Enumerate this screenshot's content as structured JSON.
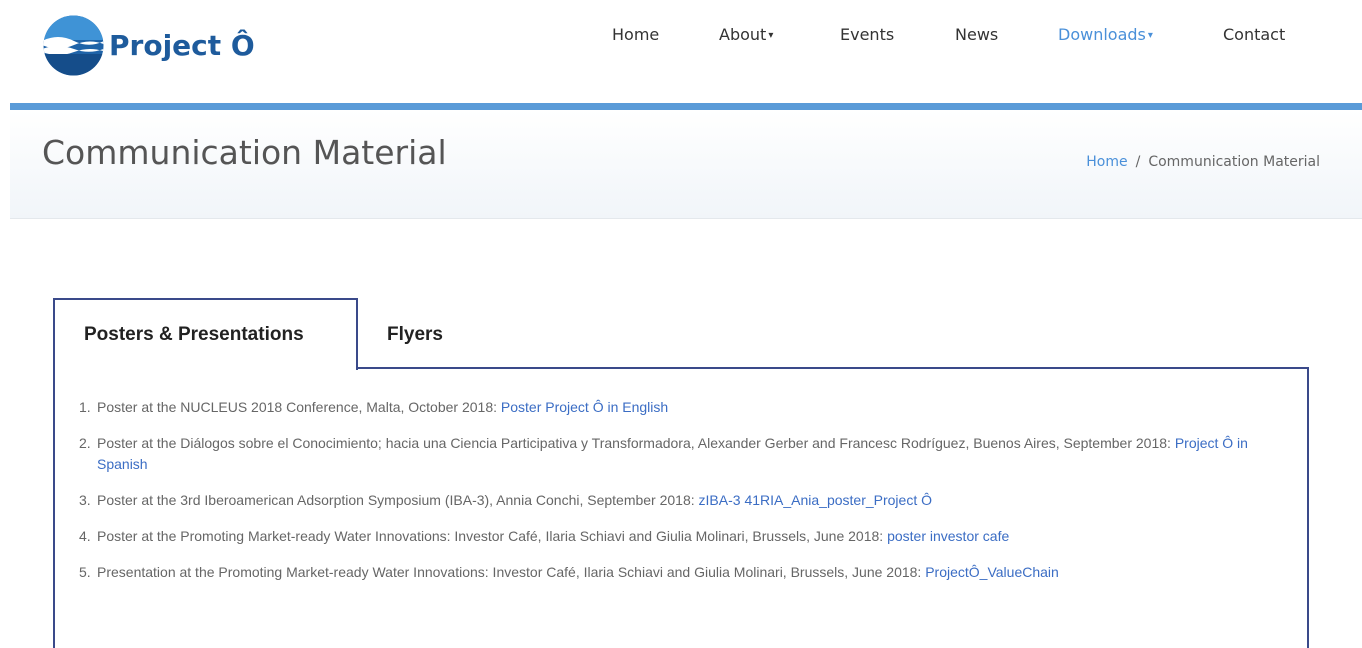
{
  "brand": {
    "name": "Project Ô",
    "logo_icon": "wave-globe-logo",
    "color": "#1e5b9c"
  },
  "nav": {
    "items": [
      {
        "label": "Home",
        "has_caret": false,
        "active": false
      },
      {
        "label": "About",
        "has_caret": true,
        "active": false
      },
      {
        "label": "Events",
        "has_caret": false,
        "active": false
      },
      {
        "label": "News",
        "has_caret": false,
        "active": false
      },
      {
        "label": "Downloads",
        "has_caret": true,
        "active": true
      },
      {
        "label": "Contact",
        "has_caret": false,
        "active": false
      }
    ],
    "accent_color": "#4a90d9"
  },
  "page": {
    "title": "Communication Material",
    "breadcrumb": {
      "home": "Home",
      "separator": "/",
      "current": "Communication Material"
    }
  },
  "tabs": [
    {
      "label": "Posters & Presentations",
      "active": true
    },
    {
      "label": "Flyers",
      "active": false
    }
  ],
  "items": [
    {
      "num": "1.",
      "text": "Poster at the NUCLEUS 2018 Conference, Malta, October 2018: ",
      "link": "Poster Project Ô in English"
    },
    {
      "num": "2.",
      "text": "Poster at the Diálogos sobre el Conocimiento; hacia una Ciencia Participativa y Transformadora, Alexander Gerber and Francesc Rodríguez, Buenos Aires, September 2018: ",
      "link": "Project Ô in Spanish"
    },
    {
      "num": "3.",
      "text": "Poster at the 3rd Iberoamerican Adsorption Symposium (IBA-3), Annia Conchi, September 2018: ",
      "link": "zIBA-3 41RIA_Ania_poster_Project Ô"
    },
    {
      "num": "4.",
      "text": "Poster at the Promoting Market-ready Water Innovations: Investor Café, Ilaria Schiavi and Giulia Molinari, Brussels, June 2018: ",
      "link": "poster investor cafe"
    },
    {
      "num": "5.",
      "text": "Presentation at the Promoting Market-ready Water Innovations: Investor Café, Ilaria Schiavi and Giulia Molinari, Brussels, June 2018: ",
      "link": "ProjectÔ_ValueChain"
    }
  ]
}
